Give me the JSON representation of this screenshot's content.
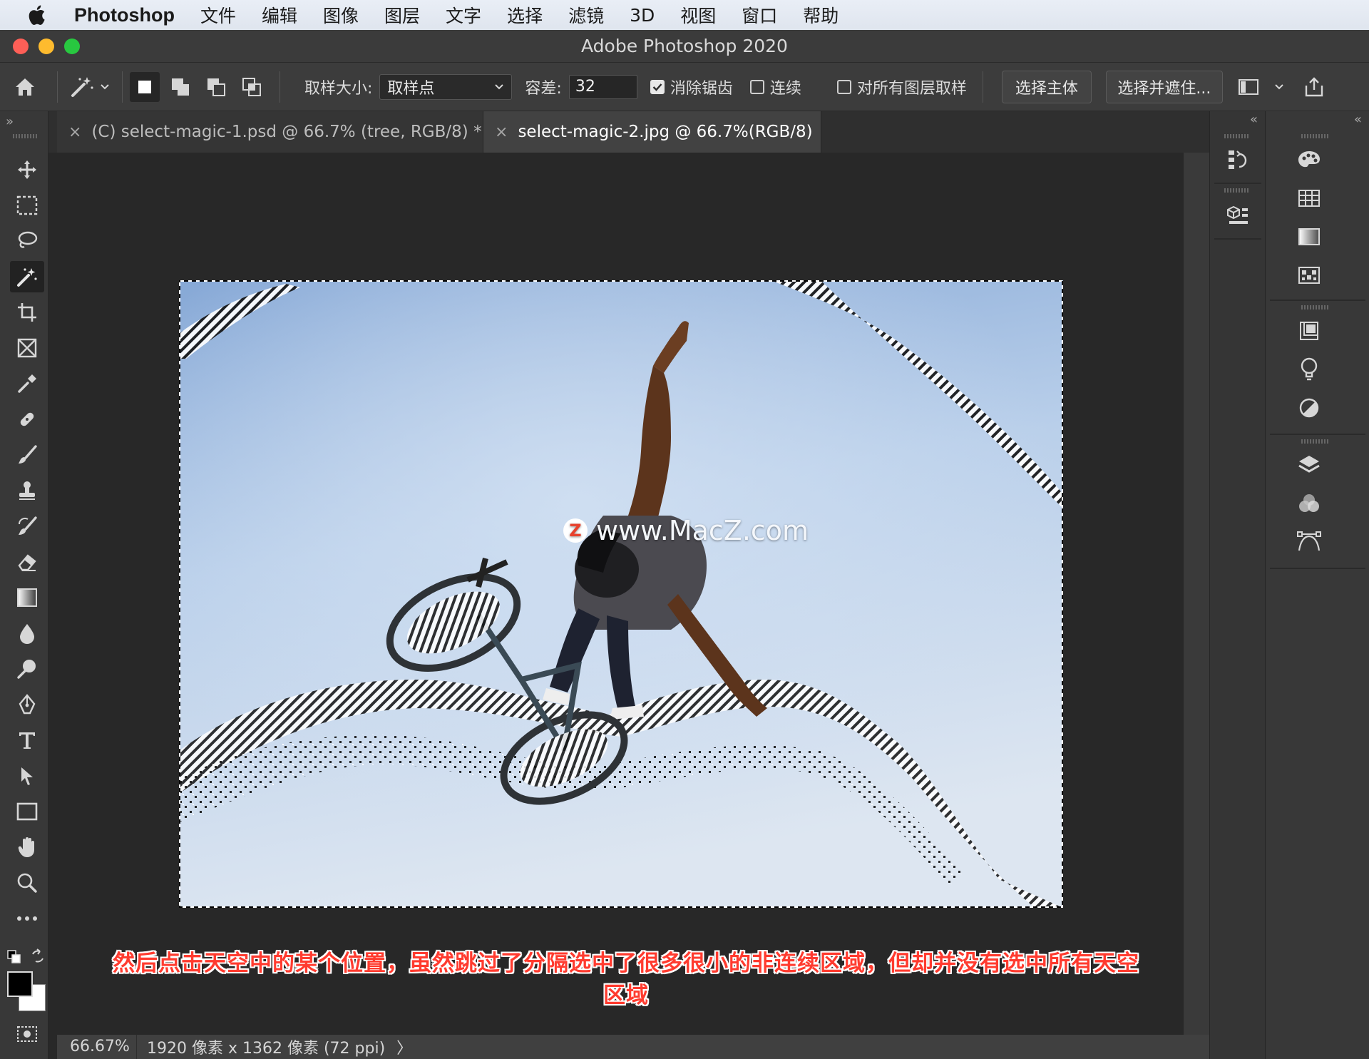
{
  "menubar": {
    "app_name": "Photoshop",
    "menus": [
      "文件",
      "编辑",
      "图像",
      "图层",
      "文字",
      "选择",
      "滤镜",
      "3D",
      "视图",
      "窗口",
      "帮助"
    ]
  },
  "window": {
    "title": "Adobe Photoshop 2020"
  },
  "options": {
    "sample_size_label": "取样大小:",
    "sample_size_value": "取样点",
    "tolerance_label": "容差:",
    "tolerance_value": "32",
    "antialias_label": "消除锯齿",
    "antialias_checked": true,
    "contiguous_label": "连续",
    "contiguous_checked": false,
    "sample_all_layers_label": "对所有图层取样",
    "sample_all_layers_checked": false,
    "select_subject_label": "选择主体",
    "select_and_mask_label": "选择并遮住..."
  },
  "tabs": [
    {
      "label": "(C) select-magic-1.psd @ 66.7% (tree, RGB/8) *",
      "active": false
    },
    {
      "label": "select-magic-2.jpg @ 66.7%(RGB/8)",
      "active": true
    }
  ],
  "tools": [
    "move-tool",
    "rectangular-marquee-tool",
    "lasso-tool",
    "magic-wand-tool",
    "crop-tool",
    "frame-tool",
    "eyedropper-tool",
    "spot-healing-brush-tool",
    "brush-tool",
    "clone-stamp-tool",
    "history-brush-tool",
    "eraser-tool",
    "gradient-tool",
    "blur-tool",
    "dodge-tool",
    "pen-tool",
    "type-tool",
    "path-selection-tool",
    "rectangle-tool",
    "hand-tool",
    "zoom-tool",
    "more-tools"
  ],
  "active_tool": "magic-wand-tool",
  "colors": {
    "foreground": "#000000",
    "background": "#ffffff",
    "caption": "#ff3b2f"
  },
  "watermark": {
    "badge": "Z",
    "text": "www.MacZ.com"
  },
  "caption": "然后点击天空中的某个位置，虽然跳过了分隔选中了很多很小的非连续区域，但却并没有选中所有天空区域",
  "status": {
    "zoom": "66.67%",
    "doc_info": "1920 像素 x 1362 像素 (72 ppi)",
    "arrow": "〉"
  },
  "dock_narrow_icons": [
    "history-icon",
    "3d-object-icon"
  ],
  "dock_wide_icons": [
    "color-palette-icon",
    "swatches-grid-icon",
    "gradients-icon",
    "patterns-icon",
    "properties-icon",
    "libraries-lightbulb-icon",
    "adjustments-icon",
    "layers-icon",
    "channels-icon",
    "paths-icon"
  ]
}
